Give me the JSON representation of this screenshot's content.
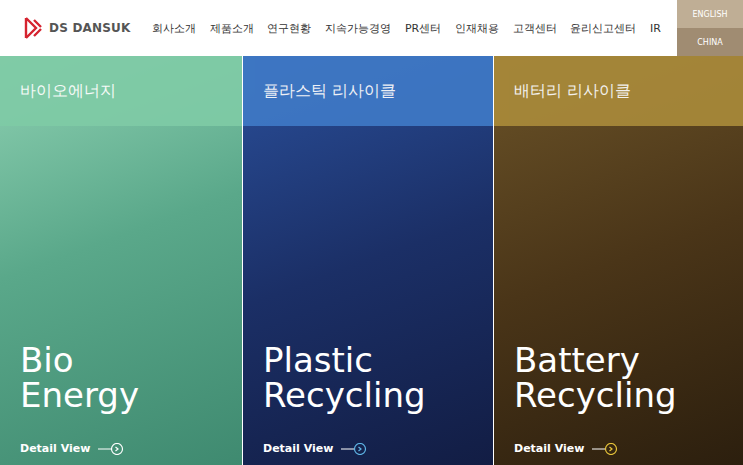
{
  "header": {
    "logo": "DS DANSUK",
    "nav": [
      "회사소개",
      "제품소개",
      "연구현황",
      "지속가능경영",
      "PR센터",
      "인재채용",
      "고객센터",
      "윤리신고센터",
      "IR"
    ],
    "languages": [
      "ENGLISH",
      "CHINA"
    ]
  },
  "panels": [
    {
      "label": "바이오에너지",
      "title": [
        "Bio",
        "Energy"
      ],
      "link": "Detail View",
      "color": "#7fcba6",
      "accent": "#ffffff"
    },
    {
      "label": "플라스틱 리사이클",
      "title": [
        "Plastic",
        "Recycling"
      ],
      "link": "Detail View",
      "color": "#3f79c6",
      "accent": "#5fb6e6"
    },
    {
      "label": "배터리 리사이클",
      "title": [
        "Battery",
        "Recycling"
      ],
      "link": "Detail View",
      "color": "#a98a3a",
      "accent": "#e8c53a"
    }
  ]
}
